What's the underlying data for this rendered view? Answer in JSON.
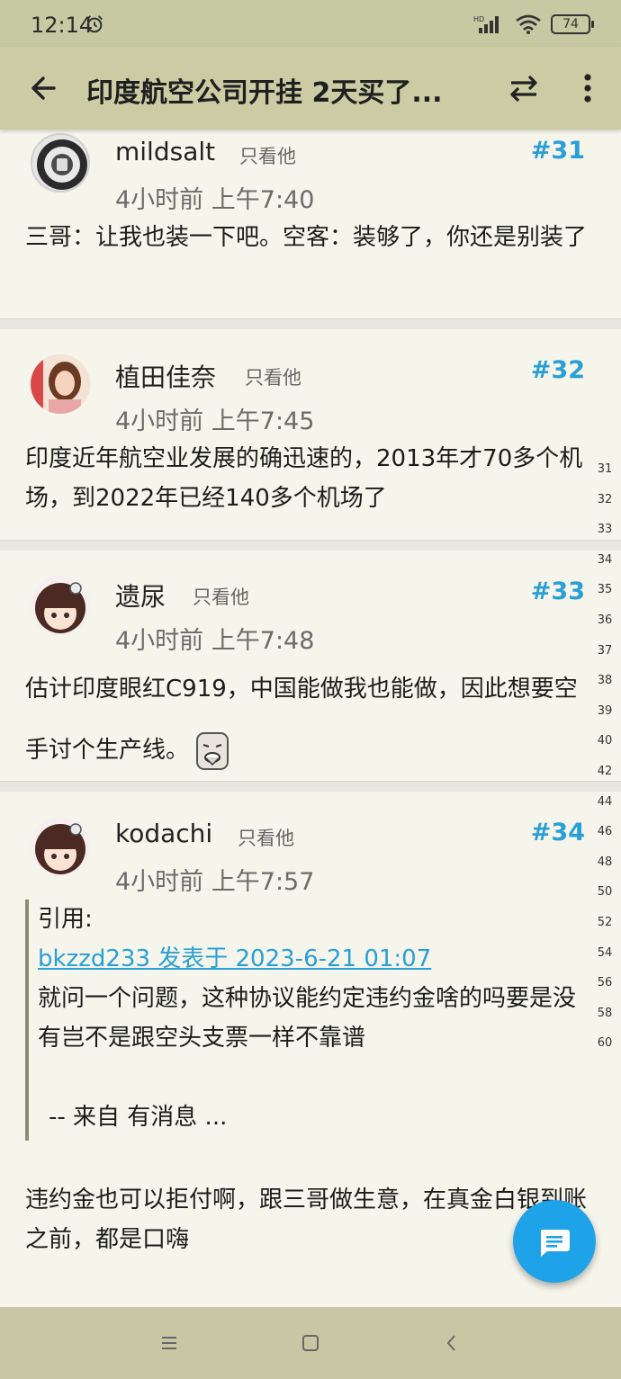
{
  "status": {
    "time": "12:14",
    "battery": "74",
    "icons": [
      "alarm-icon",
      "hd-signal-icon",
      "wifi-icon",
      "battery-icon"
    ]
  },
  "app_bar": {
    "title": "印度航空公司开挂 2天买了...",
    "back_icon": "arrow-left-icon",
    "swap_icon": "swap-horizontal-icon",
    "more_icon": "more-vertical-icon"
  },
  "posts": [
    {
      "user": "mildsalt",
      "only_him": "只看他",
      "floor": "#31",
      "time": "4小时前 上午7:40",
      "content": "三哥：让我也装一下吧。空客：装够了，你还是别装了"
    },
    {
      "user": "植田佳奈",
      "only_him": "只看他",
      "floor": "#32",
      "time": "4小时前 上午7:45",
      "content": "印度近年航空业发展的确迅速的，2013年才70多个机场，到2022年已经140多个机场了"
    },
    {
      "user": "遗尿",
      "only_him": "只看他",
      "floor": "#33",
      "time": "4小时前 上午7:48",
      "content": "估计印度眼红C919，中国能做我也能做，因此想要空手讨个生产线。"
    },
    {
      "user": "kodachi",
      "only_him": "只看他",
      "floor": "#34",
      "time": "4小时前 上午7:57",
      "quote_label": "引用:",
      "quote_link": "bkzzd233 发表于 2023-6-21 01:07",
      "quote_text": "就问一个问题，这种协议能约定违约金啥的吗要是没有岂不是跟空头支票一样不靠谱",
      "quote_footer": "-- 来自 有消息 ...",
      "content": "违约金也可以拒付啊，跟三哥做生意，在真金白银到账之前，都是口嗨"
    }
  ],
  "line_numbers": [
    "31",
    "32",
    "33",
    "34",
    "35",
    "36",
    "37",
    "38",
    "39",
    "40",
    "42",
    "44",
    "46",
    "48",
    "50",
    "52",
    "54",
    "56",
    "58",
    "60"
  ],
  "fab_icon": "chat-bubble-icon",
  "nav": {
    "icons": [
      "menu-icon",
      "home-square-icon",
      "back-chevron-icon"
    ]
  },
  "colors": {
    "accent": "#2a9fd6",
    "bar": "#cbcca4",
    "background": "#f5f5ec",
    "fab": "#1fa3e8"
  }
}
